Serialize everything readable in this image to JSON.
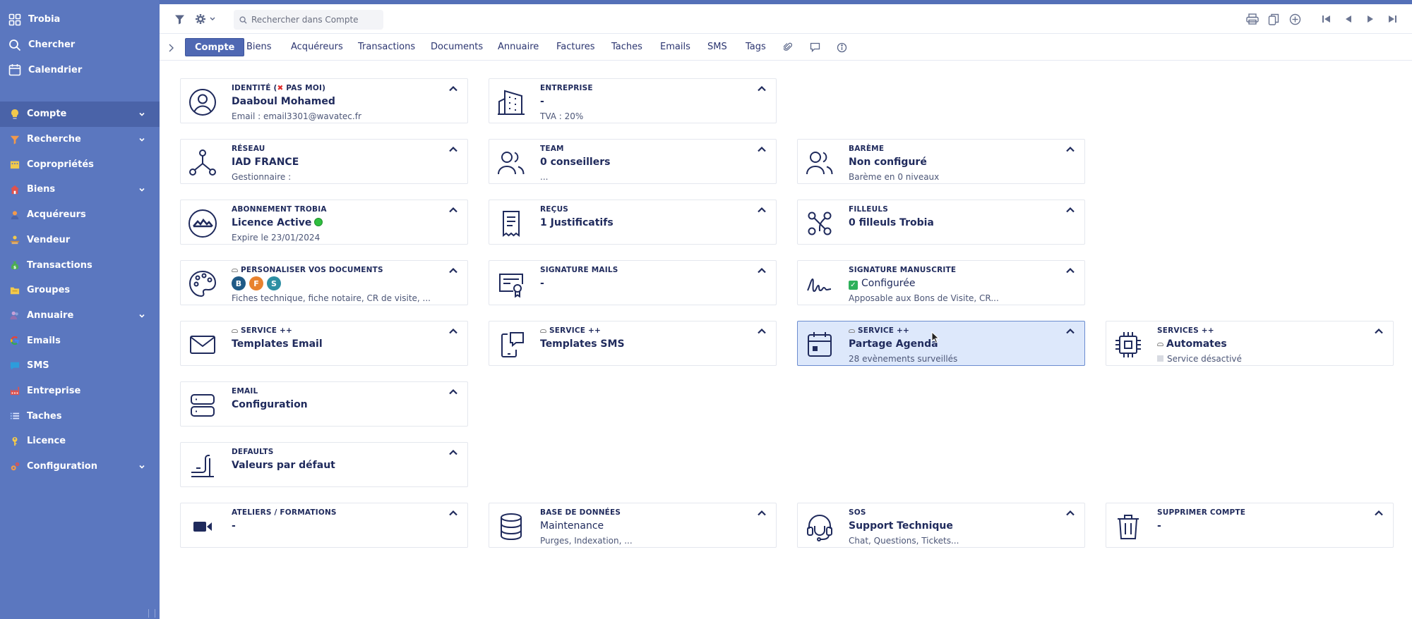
{
  "sidebar": {
    "top_items": [
      {
        "label": "Trobia",
        "icon": "grid-icon"
      },
      {
        "label": "Chercher",
        "icon": "search-icon"
      },
      {
        "label": "Calendrier",
        "icon": "calendar-icon"
      }
    ],
    "nav_items": [
      {
        "label": "Compte",
        "icon": "lightbulb-icon",
        "color": "#f2c94c",
        "has_chevron": true,
        "active": true
      },
      {
        "label": "Recherche",
        "icon": "funnel-icon",
        "color": "#f2994a",
        "has_chevron": true
      },
      {
        "label": "Copropriétés",
        "icon": "building-icon",
        "color": "#f2c94c",
        "has_chevron": false
      },
      {
        "label": "Biens",
        "icon": "house-icon",
        "color": "#e0524d",
        "has_chevron": true
      },
      {
        "label": "Acquéreurs",
        "icon": "person-icon",
        "color": "#f2994a",
        "has_chevron": false
      },
      {
        "label": "Vendeur",
        "icon": "seller-icon",
        "color": "#f2c94c",
        "has_chevron": false
      },
      {
        "label": "Transactions",
        "icon": "money-bag-icon",
        "color": "#4caf50",
        "has_chevron": false
      },
      {
        "label": "Groupes",
        "icon": "folder-icon",
        "color": "#f2c94c",
        "has_chevron": false
      },
      {
        "label": "Annuaire",
        "icon": "contacts-icon",
        "color": "#c7a0d8",
        "has_chevron": true
      },
      {
        "label": "Emails",
        "icon": "google-icon",
        "color": "#ea4335",
        "has_chevron": false
      },
      {
        "label": "SMS",
        "icon": "chat-icon",
        "color": "#2d9cdb",
        "has_chevron": false
      },
      {
        "label": "Entreprise",
        "icon": "factory-icon",
        "color": "#e0524d",
        "has_chevron": false
      },
      {
        "label": "Taches",
        "icon": "list-icon",
        "color": "#a0c4ff",
        "has_chevron": false
      },
      {
        "label": "Licence",
        "icon": "key-icon",
        "color": "#f2c94c",
        "has_chevron": false
      },
      {
        "label": "Configuration",
        "icon": "gears-icon",
        "color": "#f2994a",
        "has_chevron": true
      }
    ]
  },
  "toolbar": {
    "search_placeholder": "Rechercher dans Compte"
  },
  "tabs": [
    "Compte",
    "Biens",
    "Acquéreurs",
    "Transactions",
    "Documents",
    "Annuaire",
    "Factures",
    "Taches",
    "Emails",
    "SMS",
    "Tags"
  ],
  "active_tab": "Compte",
  "cards": {
    "identite": {
      "title_pre": "IDENTITÉ (",
      "title_post": " PAS MOI)",
      "value": "Daaboul Mohamed",
      "sub": "Email : email3301@wavatec.fr"
    },
    "entreprise": {
      "title": "ENTREPRISE",
      "value": "-",
      "sub": "TVA : 20%"
    },
    "reseau": {
      "title": "RÉSEAU",
      "value": "IAD FRANCE",
      "sub": "Gestionnaire :"
    },
    "team": {
      "title": "TEAM",
      "value": "0 conseillers",
      "sub": "..."
    },
    "bareme": {
      "title": "BARÈME",
      "value": "Non configuré",
      "sub": "Barème en 0 niveaux"
    },
    "abonnement": {
      "title": "ABONNEMENT TROBIA",
      "value": "Licence Active",
      "sub": "Expire le 23/01/2024"
    },
    "recus": {
      "title": "REÇUS",
      "value": "1 Justificatifs"
    },
    "filleuls": {
      "title": "FILLEULS",
      "value": "0 filleuls Trobia"
    },
    "personaliser": {
      "title": "PERSONALISER VOS DOCUMENTS",
      "badges": [
        {
          "letter": "B",
          "color": "#1f5a86"
        },
        {
          "letter": "F",
          "color": "#e8822e"
        },
        {
          "letter": "S",
          "color": "#2e8fa3"
        }
      ],
      "sub": "Fiches technique, fiche notaire, CR de visite, ..."
    },
    "signature_mails": {
      "title": "SIGNATURE MAILS",
      "value": "-"
    },
    "signature_manuscrite": {
      "title": "SIGNATURE MANUSCRITE",
      "value": "Configurée",
      "sub": "Apposable aux Bons de Visite, CR..."
    },
    "templates_email": {
      "title": "SERVICE ++",
      "value": "Templates Email"
    },
    "templates_sms": {
      "title": "SERVICE ++",
      "value": "Templates SMS"
    },
    "partage_agenda": {
      "title": "SERVICE ++",
      "value": "Partage Agenda",
      "sub": "28 evènements surveillés"
    },
    "automates": {
      "title": "SERVICES ++",
      "value": "Automates",
      "sub": "Service désactivé"
    },
    "email_config": {
      "title": "EMAIL",
      "value": "Configuration"
    },
    "defaults": {
      "title": "DEFAULTS",
      "value": "Valeurs par défaut"
    },
    "ateliers": {
      "title": "ATELIERS / FORMATIONS",
      "value": "-"
    },
    "base_donnees": {
      "title": "BASE DE DONNÉES",
      "value": "Maintenance",
      "sub": "Purges, Indexation, ..."
    },
    "sos": {
      "title": "SOS",
      "value": "Support Technique",
      "sub": "Chat, Questions, Tickets..."
    },
    "supprimer": {
      "title": "SUPPRIMER COMPTE",
      "value": "-"
    }
  }
}
